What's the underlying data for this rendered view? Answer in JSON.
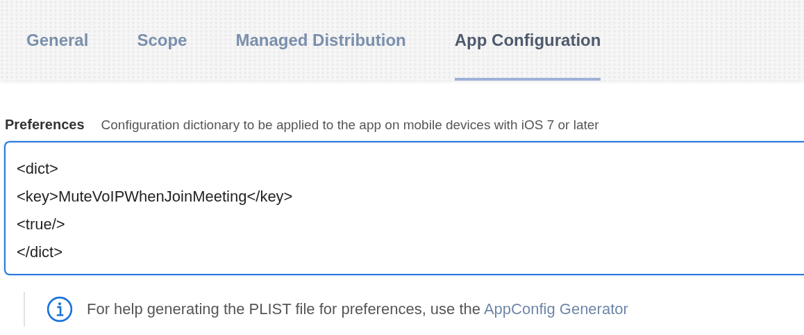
{
  "tabs": [
    {
      "label": "General",
      "selected": false
    },
    {
      "label": "Scope",
      "selected": false
    },
    {
      "label": "Managed Distribution",
      "selected": false
    },
    {
      "label": "App Configuration",
      "selected": true
    }
  ],
  "preferences": {
    "label": "Preferences",
    "description": "Configuration dictionary to be applied to the app on mobile devices with iOS 7 or later",
    "value": "<dict>\n<key>MuteVoIPWhenJoinMeeting</key>\n<true/>\n</dict>"
  },
  "help": {
    "text": "For help generating the PLIST file for preferences, use the",
    "link": "AppConfig Generator"
  }
}
